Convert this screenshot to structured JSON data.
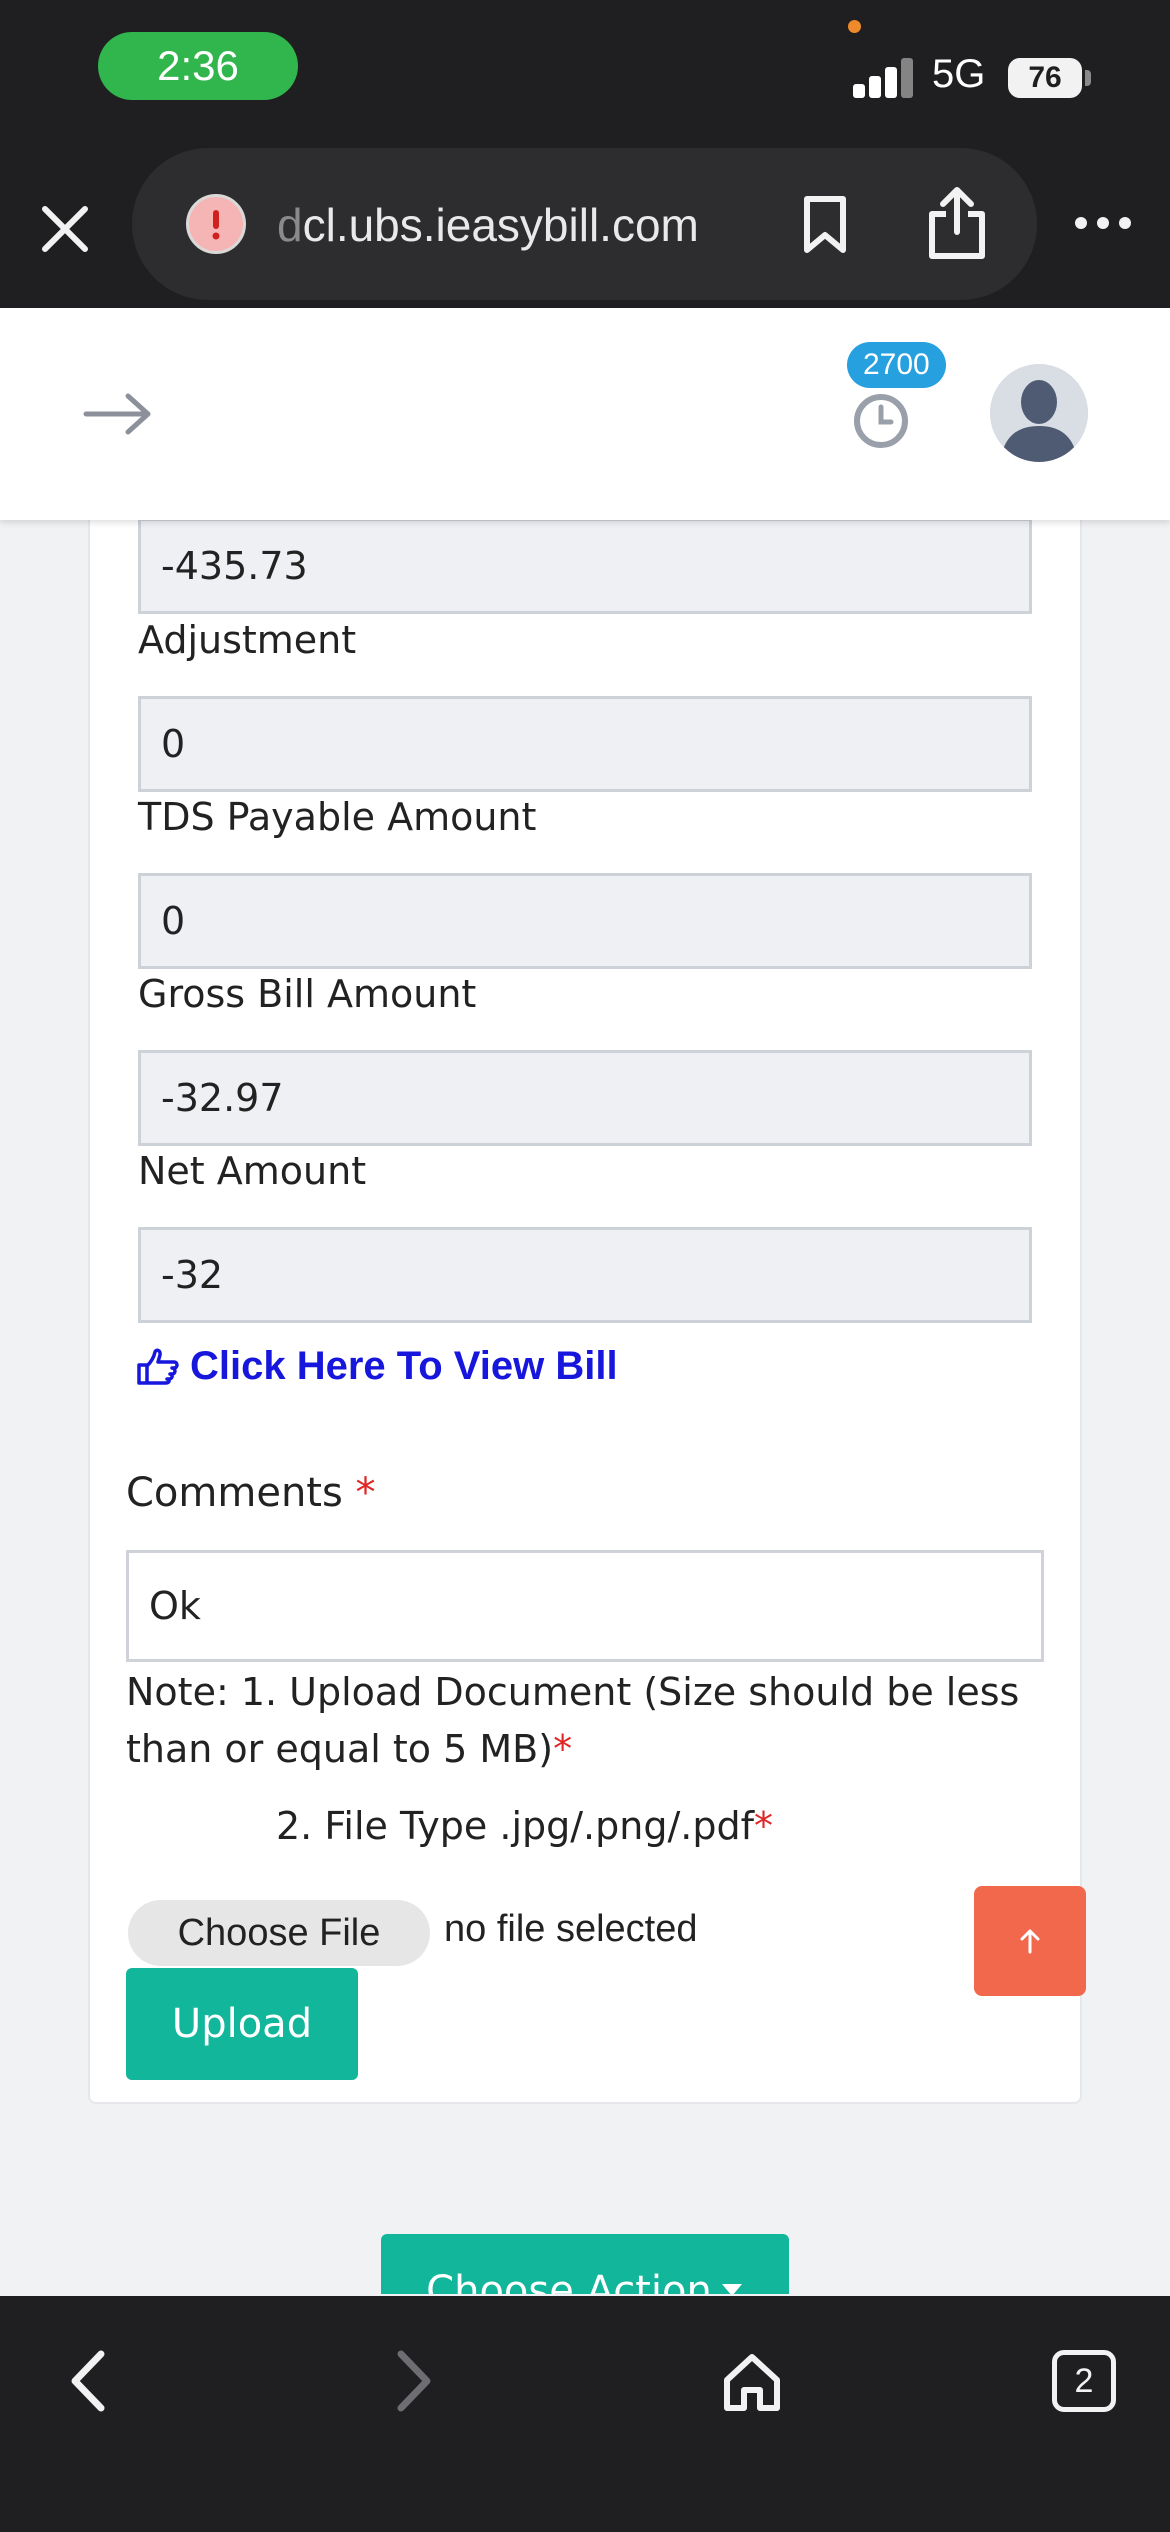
{
  "status_bar": {
    "time": "2:36",
    "network": "5G",
    "battery": "76"
  },
  "browser": {
    "url_faded": "d",
    "url_main": "cl.ubs.ieasybill.com",
    "icons": [
      "close-icon",
      "warning-icon",
      "bookmark-icon",
      "share-icon",
      "more-icon"
    ]
  },
  "header": {
    "notification_count": "2700",
    "icons": [
      "arrow-right-icon",
      "clock-icon",
      "avatar"
    ]
  },
  "form": {
    "top_value": "-435.73",
    "fields": [
      {
        "label": "Adjustment",
        "value": "0"
      },
      {
        "label": "TDS Payable Amount",
        "value": "0"
      },
      {
        "label": "Gross Bill Amount",
        "value": "-32.97"
      },
      {
        "label": "Net Amount",
        "value": "-32"
      }
    ],
    "view_bill_link": "Click Here To View Bill",
    "comments_label": "Comments",
    "required_mark": "*",
    "comments_value": "Ok",
    "note_line_1": "Note: 1. Upload Document (Size should be less than or equal to 5 MB)",
    "note_line_2": "2. File Type .jpg/.png/.pdf",
    "choose_file_label": "Choose File",
    "no_file_text": "no file selected",
    "upload_label": "Upload",
    "choose_action_label": "Choose Action"
  },
  "toolbar": {
    "tab_count": "2"
  },
  "colors": {
    "accent_teal": "#12b69a",
    "link_blue": "#1616dd",
    "scroll_top_orange": "#f2684d",
    "badge_blue": "#27a0e0",
    "required_red": "#e02525"
  }
}
